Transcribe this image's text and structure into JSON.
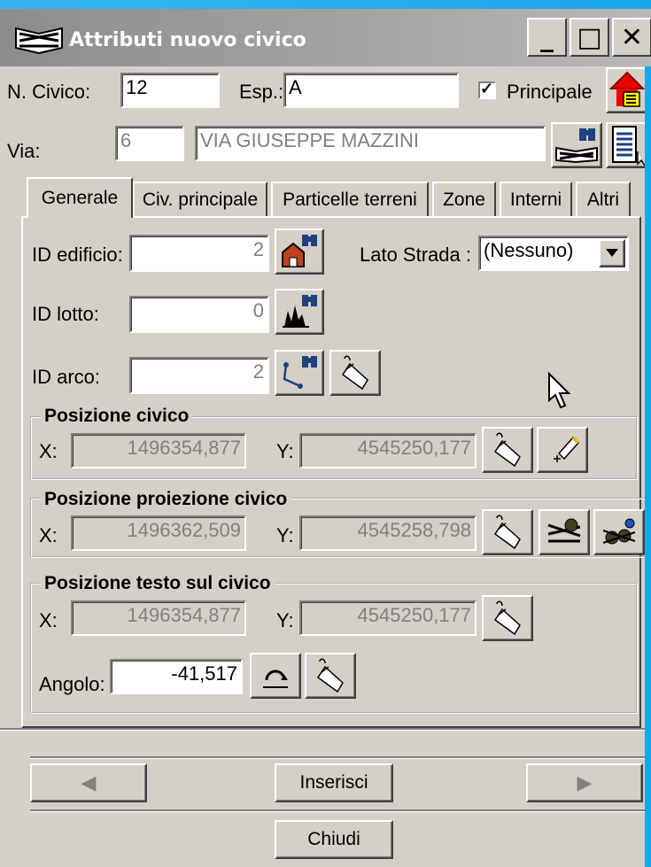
{
  "window": {
    "title": "Attributi nuovo civico"
  },
  "titlebar": {
    "minimize": "_",
    "maximize": "□",
    "close": "✕"
  },
  "header": {
    "n_civico_label": "N. Civico:",
    "n_civico_value": "12",
    "esp_label": "Esp.:",
    "esp_value": "A",
    "principale_label": "Principale",
    "principale_checked": "✓",
    "via_label": "Via:",
    "via_code": "6",
    "via_name": "VIA GIUSEPPE MAZZINI"
  },
  "tabs": [
    {
      "label": "Generale"
    },
    {
      "label": "Civ. principale"
    },
    {
      "label": "Particelle terreni"
    },
    {
      "label": "Zone"
    },
    {
      "label": "Interni"
    },
    {
      "label": "Altri"
    }
  ],
  "generale": {
    "id_edificio_label": "ID edificio:",
    "id_edificio_value": "2",
    "lato_strada_label": "Lato Strada :",
    "lato_strada_value": "(Nessuno)",
    "id_lotto_label": "ID lotto:",
    "id_lotto_value": "0",
    "id_arco_label": "ID arco:",
    "id_arco_value": "2"
  },
  "posizione_civico": {
    "title": "Posizione civico",
    "x_label": "X:",
    "x": "1496354,877",
    "y_label": "Y:",
    "y": "4545250,177"
  },
  "posizione_proiezione": {
    "title": "Posizione proiezione civico",
    "x_label": "X:",
    "x": "1496362,509",
    "y_label": "Y:",
    "y": "4545258,798"
  },
  "posizione_testo": {
    "title": "Posizione testo sul civico",
    "x_label": "X:",
    "x": "1496354,877",
    "y_label": "Y:",
    "y": "4545250,177",
    "angolo_label": "Angolo:",
    "angolo": "-41,517"
  },
  "footer": {
    "prev": "◀",
    "insert": "Inserisci",
    "next": "▶",
    "close": "Chiudi"
  },
  "icons": [
    "app-icon",
    "house-alert-icon",
    "binoculars-road-icon",
    "document-icon",
    "binoculars-house-icon",
    "binoculars-lot-icon",
    "binoculars-arc-icon",
    "mouse-icon",
    "pen-point-icon",
    "road-point-icon",
    "points-icon",
    "rotate-icon",
    "cursor-icon"
  ]
}
